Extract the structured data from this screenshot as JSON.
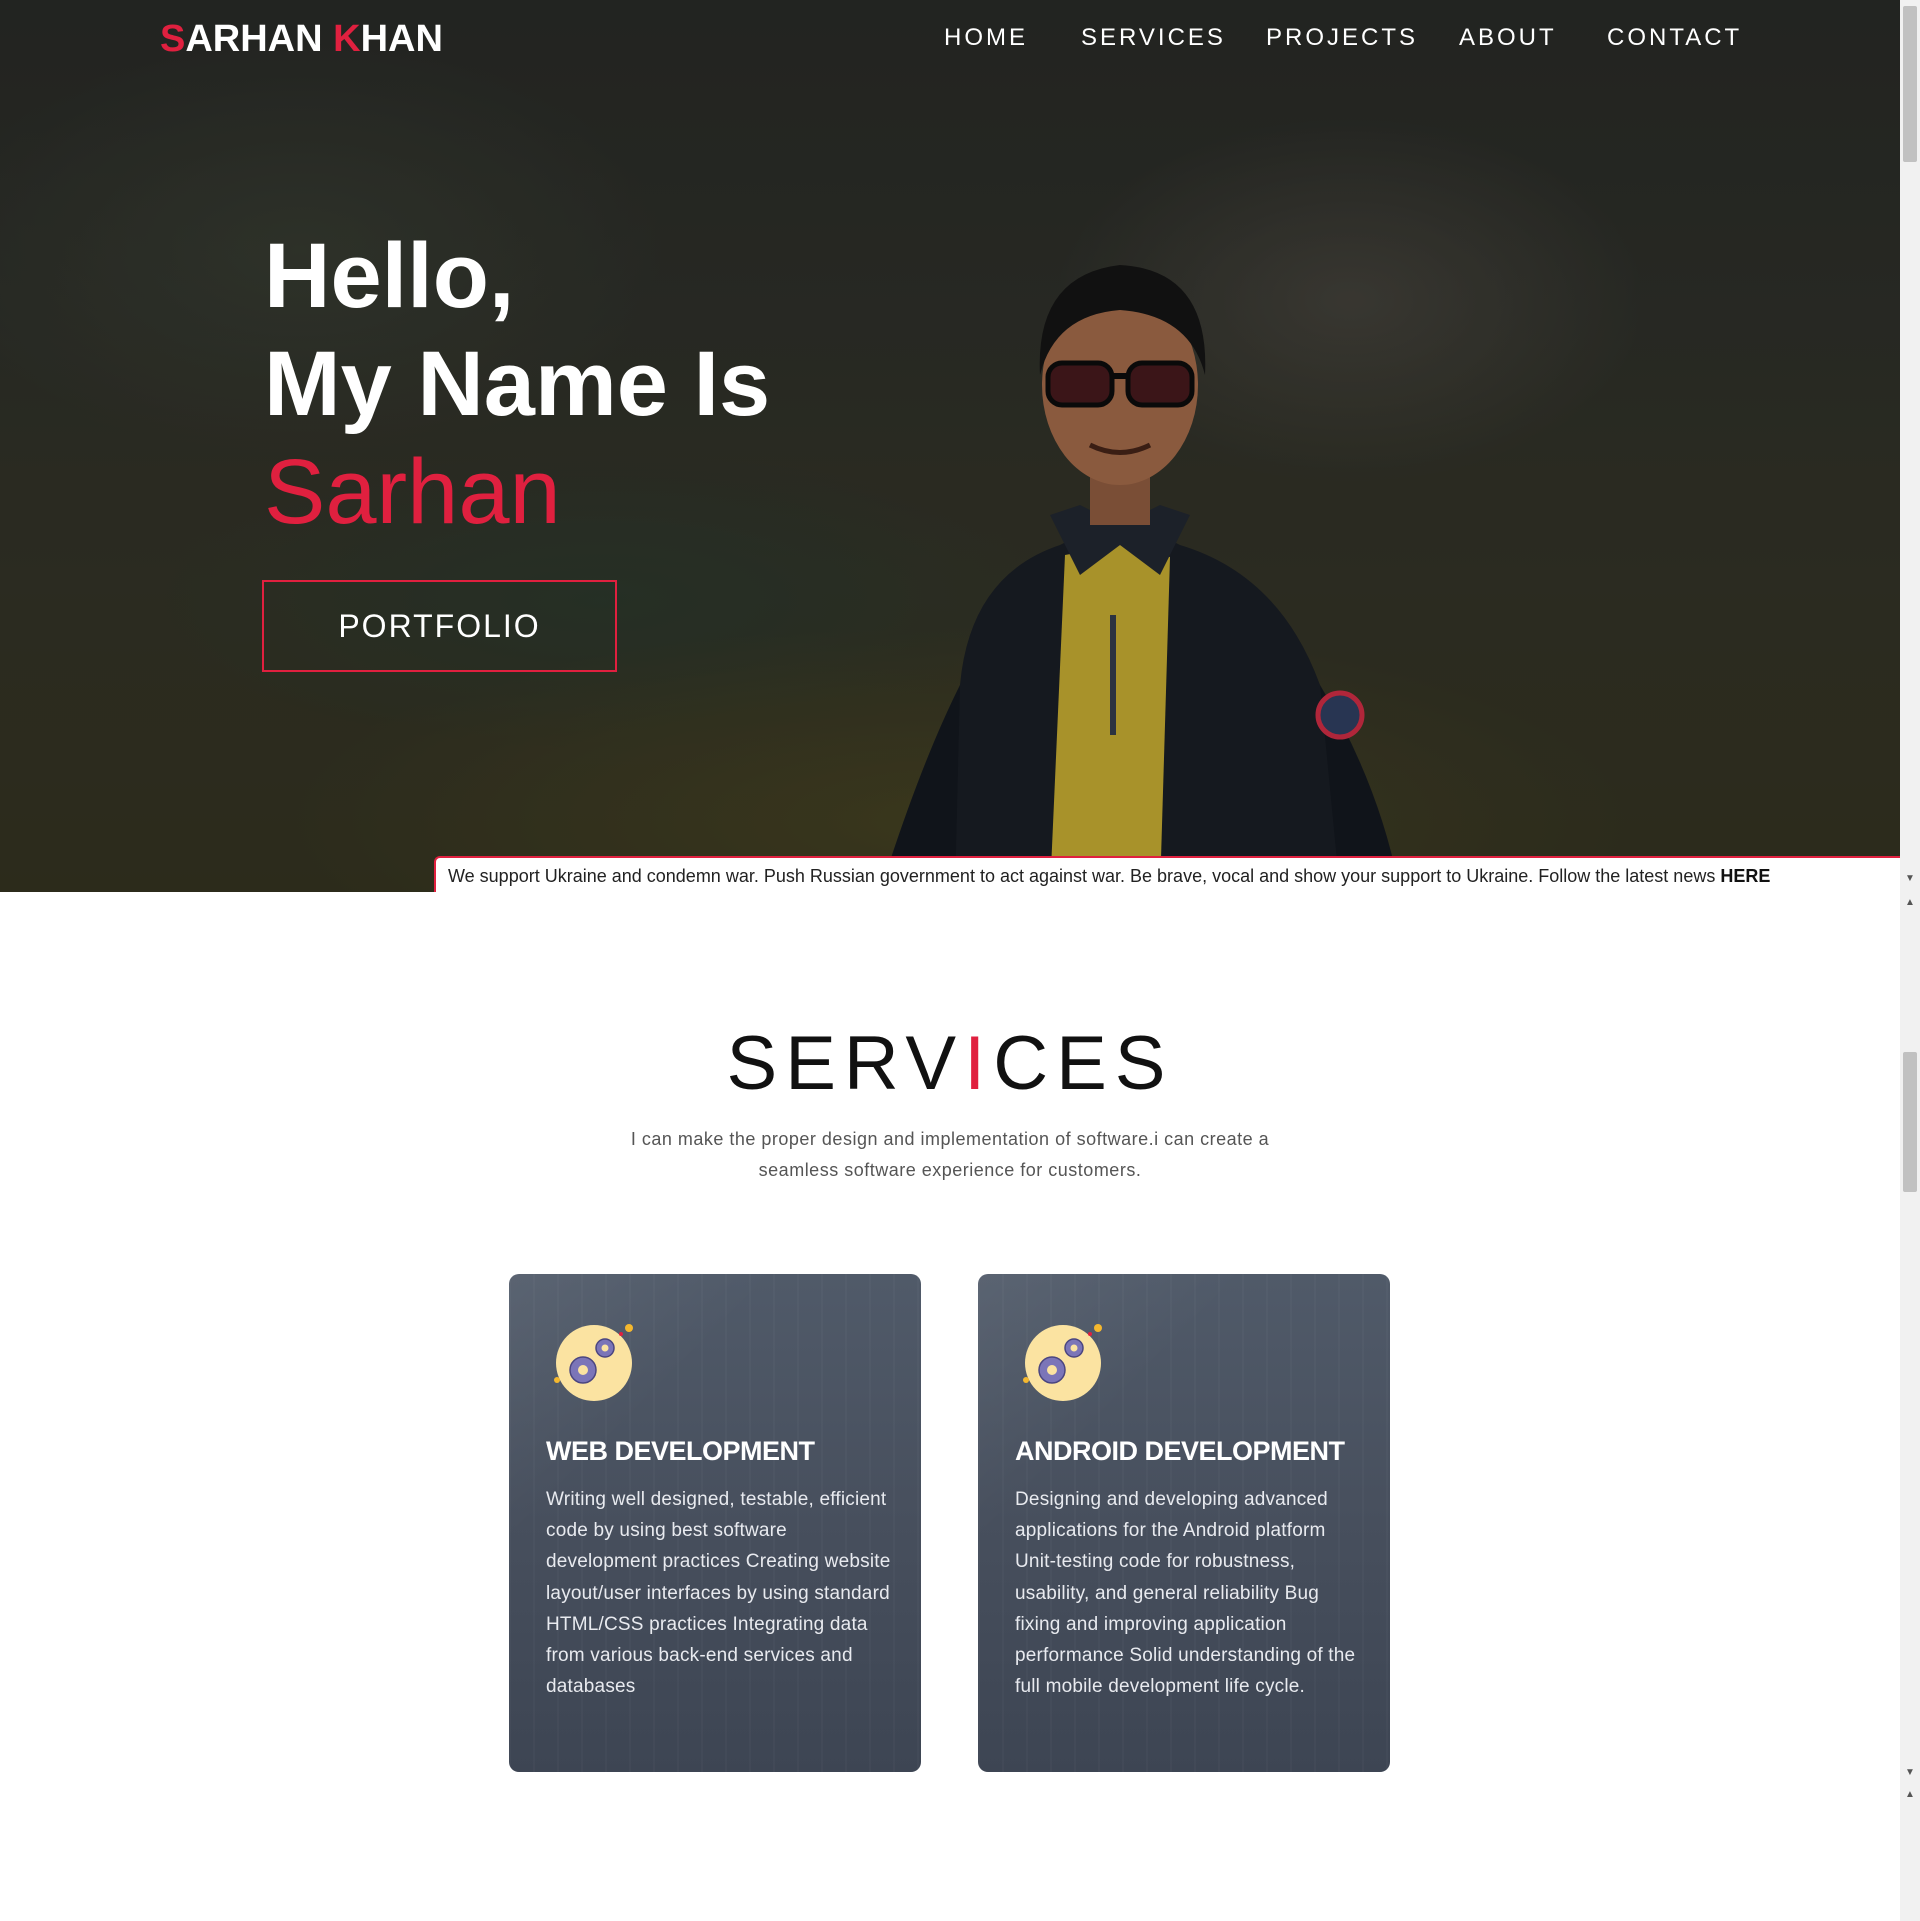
{
  "nav": {
    "logo_first_initial": "S",
    "logo_first_rest": "ARHAN",
    "logo_last_initial": "K",
    "logo_last_rest": "HAN",
    "items": [
      "HOME",
      "SERVICES",
      "PROJECTS",
      "ABOUT",
      "CONTACT"
    ]
  },
  "hero": {
    "line1": "Hello,",
    "line2": "My Name Is",
    "name": "Sarhan",
    "button_label": "PORTFOLIO"
  },
  "banner": {
    "text": "We support Ukraine and condemn war. Push Russian government to act against war. Be brave, vocal and show your support to Ukraine. Follow the latest news ",
    "link_label": "HERE"
  },
  "services": {
    "title_left": "SERV",
    "title_bar": "I",
    "title_right": "CES",
    "subtitle": "I can make the proper design and implementation of software.i can create a seamless software experience for customers.",
    "cards": [
      {
        "title": "WEB DEVELOPMENT",
        "body": "Writing well designed, testable, efficient code by using best software development practices Creating website layout/user interfaces by using standard HTML/CSS practices Integrating data from various back-end services and databases",
        "icon": "gears-icon"
      },
      {
        "title": "ANDROID DEVELOPMENT",
        "body": "Designing and developing advanced applications for the Android platform Unit-testing code for robustness, usability, and general reliability Bug fixing and improving application performance Solid understanding of the full mobile development life cycle.",
        "icon": "gears-icon"
      }
    ]
  },
  "colors": {
    "accent": "#e0203f",
    "card_bg": "#4a5261"
  }
}
